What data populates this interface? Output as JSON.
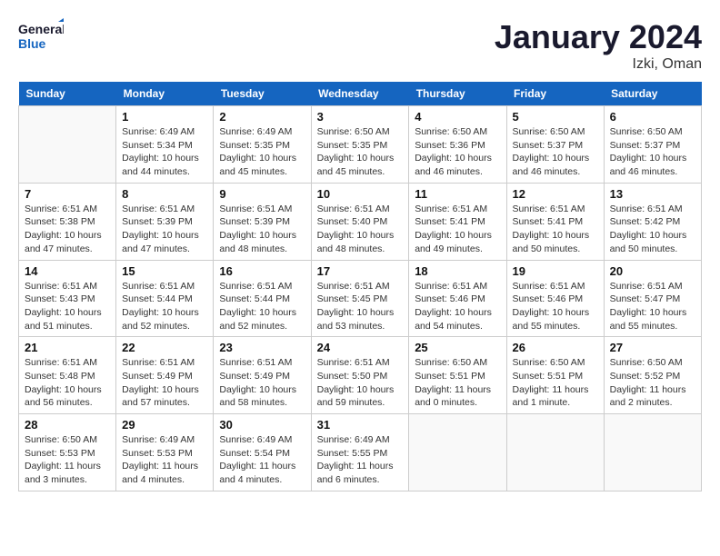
{
  "header": {
    "logo_general": "General",
    "logo_blue": "Blue",
    "title": "January 2024",
    "subtitle": "Izki, Oman"
  },
  "days_of_week": [
    "Sunday",
    "Monday",
    "Tuesday",
    "Wednesday",
    "Thursday",
    "Friday",
    "Saturday"
  ],
  "weeks": [
    [
      {
        "day": "",
        "info": ""
      },
      {
        "day": "1",
        "info": "Sunrise: 6:49 AM\nSunset: 5:34 PM\nDaylight: 10 hours\nand 44 minutes."
      },
      {
        "day": "2",
        "info": "Sunrise: 6:49 AM\nSunset: 5:35 PM\nDaylight: 10 hours\nand 45 minutes."
      },
      {
        "day": "3",
        "info": "Sunrise: 6:50 AM\nSunset: 5:35 PM\nDaylight: 10 hours\nand 45 minutes."
      },
      {
        "day": "4",
        "info": "Sunrise: 6:50 AM\nSunset: 5:36 PM\nDaylight: 10 hours\nand 46 minutes."
      },
      {
        "day": "5",
        "info": "Sunrise: 6:50 AM\nSunset: 5:37 PM\nDaylight: 10 hours\nand 46 minutes."
      },
      {
        "day": "6",
        "info": "Sunrise: 6:50 AM\nSunset: 5:37 PM\nDaylight: 10 hours\nand 46 minutes."
      }
    ],
    [
      {
        "day": "7",
        "info": "Sunrise: 6:51 AM\nSunset: 5:38 PM\nDaylight: 10 hours\nand 47 minutes."
      },
      {
        "day": "8",
        "info": "Sunrise: 6:51 AM\nSunset: 5:39 PM\nDaylight: 10 hours\nand 47 minutes."
      },
      {
        "day": "9",
        "info": "Sunrise: 6:51 AM\nSunset: 5:39 PM\nDaylight: 10 hours\nand 48 minutes."
      },
      {
        "day": "10",
        "info": "Sunrise: 6:51 AM\nSunset: 5:40 PM\nDaylight: 10 hours\nand 48 minutes."
      },
      {
        "day": "11",
        "info": "Sunrise: 6:51 AM\nSunset: 5:41 PM\nDaylight: 10 hours\nand 49 minutes."
      },
      {
        "day": "12",
        "info": "Sunrise: 6:51 AM\nSunset: 5:41 PM\nDaylight: 10 hours\nand 50 minutes."
      },
      {
        "day": "13",
        "info": "Sunrise: 6:51 AM\nSunset: 5:42 PM\nDaylight: 10 hours\nand 50 minutes."
      }
    ],
    [
      {
        "day": "14",
        "info": "Sunrise: 6:51 AM\nSunset: 5:43 PM\nDaylight: 10 hours\nand 51 minutes."
      },
      {
        "day": "15",
        "info": "Sunrise: 6:51 AM\nSunset: 5:44 PM\nDaylight: 10 hours\nand 52 minutes."
      },
      {
        "day": "16",
        "info": "Sunrise: 6:51 AM\nSunset: 5:44 PM\nDaylight: 10 hours\nand 52 minutes."
      },
      {
        "day": "17",
        "info": "Sunrise: 6:51 AM\nSunset: 5:45 PM\nDaylight: 10 hours\nand 53 minutes."
      },
      {
        "day": "18",
        "info": "Sunrise: 6:51 AM\nSunset: 5:46 PM\nDaylight: 10 hours\nand 54 minutes."
      },
      {
        "day": "19",
        "info": "Sunrise: 6:51 AM\nSunset: 5:46 PM\nDaylight: 10 hours\nand 55 minutes."
      },
      {
        "day": "20",
        "info": "Sunrise: 6:51 AM\nSunset: 5:47 PM\nDaylight: 10 hours\nand 55 minutes."
      }
    ],
    [
      {
        "day": "21",
        "info": "Sunrise: 6:51 AM\nSunset: 5:48 PM\nDaylight: 10 hours\nand 56 minutes."
      },
      {
        "day": "22",
        "info": "Sunrise: 6:51 AM\nSunset: 5:49 PM\nDaylight: 10 hours\nand 57 minutes."
      },
      {
        "day": "23",
        "info": "Sunrise: 6:51 AM\nSunset: 5:49 PM\nDaylight: 10 hours\nand 58 minutes."
      },
      {
        "day": "24",
        "info": "Sunrise: 6:51 AM\nSunset: 5:50 PM\nDaylight: 10 hours\nand 59 minutes."
      },
      {
        "day": "25",
        "info": "Sunrise: 6:50 AM\nSunset: 5:51 PM\nDaylight: 11 hours\nand 0 minutes."
      },
      {
        "day": "26",
        "info": "Sunrise: 6:50 AM\nSunset: 5:51 PM\nDaylight: 11 hours\nand 1 minute."
      },
      {
        "day": "27",
        "info": "Sunrise: 6:50 AM\nSunset: 5:52 PM\nDaylight: 11 hours\nand 2 minutes."
      }
    ],
    [
      {
        "day": "28",
        "info": "Sunrise: 6:50 AM\nSunset: 5:53 PM\nDaylight: 11 hours\nand 3 minutes."
      },
      {
        "day": "29",
        "info": "Sunrise: 6:49 AM\nSunset: 5:53 PM\nDaylight: 11 hours\nand 4 minutes."
      },
      {
        "day": "30",
        "info": "Sunrise: 6:49 AM\nSunset: 5:54 PM\nDaylight: 11 hours\nand 4 minutes."
      },
      {
        "day": "31",
        "info": "Sunrise: 6:49 AM\nSunset: 5:55 PM\nDaylight: 11 hours\nand 6 minutes."
      },
      {
        "day": "",
        "info": ""
      },
      {
        "day": "",
        "info": ""
      },
      {
        "day": "",
        "info": ""
      }
    ]
  ]
}
